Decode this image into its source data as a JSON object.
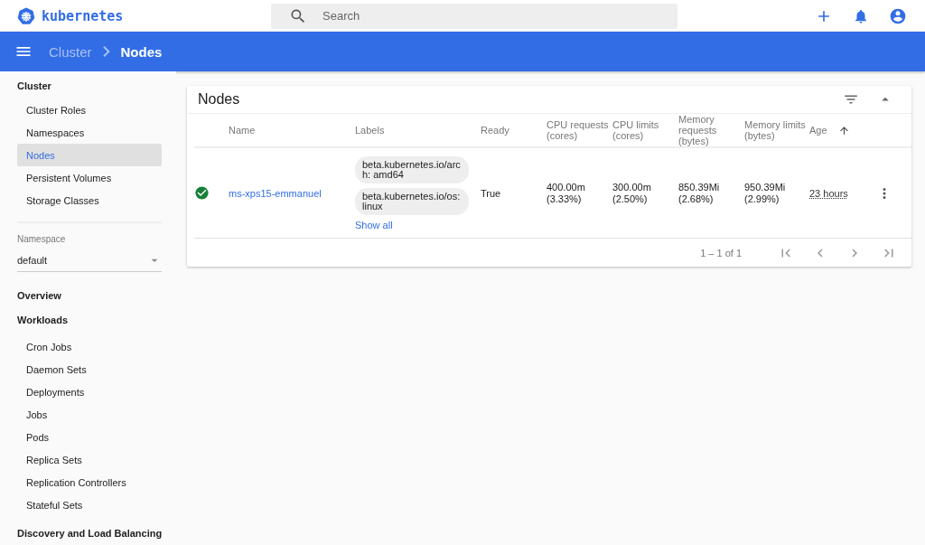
{
  "header": {
    "brand": "kubernetes",
    "search": {
      "placeholder": "Search"
    }
  },
  "toolbar": {
    "breadcrumbs": [
      {
        "label": "Cluster",
        "current": false
      },
      {
        "label": "Nodes",
        "current": true
      }
    ]
  },
  "sidebar": [
    {
      "kind": "section",
      "title": "Cluster",
      "items": [
        {
          "label": "Cluster Roles",
          "selected": false
        },
        {
          "label": "Namespaces",
          "selected": false
        },
        {
          "label": "Nodes",
          "selected": true
        },
        {
          "label": "Persistent Volumes",
          "selected": false
        },
        {
          "label": "Storage Classes",
          "selected": false
        }
      ]
    },
    {
      "kind": "namespace",
      "label": "Namespace",
      "value": "default"
    },
    {
      "kind": "section",
      "title": "Overview"
    },
    {
      "kind": "section",
      "title": "Workloads",
      "items": [
        {
          "label": "Cron Jobs",
          "selected": false
        },
        {
          "label": "Daemon Sets",
          "selected": false
        },
        {
          "label": "Deployments",
          "selected": false
        },
        {
          "label": "Jobs",
          "selected": false
        },
        {
          "label": "Pods",
          "selected": false
        },
        {
          "label": "Replica Sets",
          "selected": false
        },
        {
          "label": "Replication Controllers",
          "selected": false
        },
        {
          "label": "Stateful Sets",
          "selected": false
        }
      ]
    },
    {
      "kind": "section",
      "title": "Discovery and Load Balancing"
    }
  ],
  "card": {
    "title": "Nodes",
    "columns": [
      {
        "label": "Name",
        "sorted": false
      },
      {
        "label": "Labels",
        "sorted": false
      },
      {
        "label": "Ready",
        "sorted": false
      },
      {
        "label": "CPU requests (cores)",
        "sorted": false
      },
      {
        "label": "CPU limits (cores)",
        "sorted": false
      },
      {
        "label": "Memory requests (bytes)",
        "sorted": false
      },
      {
        "label": "Memory limits (bytes)",
        "sorted": false
      },
      {
        "label": "Age",
        "sorted": true
      }
    ],
    "rows": [
      {
        "healthy": true,
        "name": "ms-xps15-emmanuel",
        "labels": [
          "beta.kubernetes.io/arch: amd64",
          "beta.kubernetes.io/os: linux"
        ],
        "show_all": "Show all",
        "ready": "True",
        "cpu_requests": [
          "400.00m",
          "(3.33%)"
        ],
        "cpu_limits": [
          "300.00m",
          "(2.50%)"
        ],
        "memory_requests": [
          "850.39Mi",
          "(2.68%)"
        ],
        "memory_limits": [
          "950.39Mi",
          "(2.99%)"
        ],
        "age": "23 hours"
      }
    ],
    "pagination": "1 – 1 of 1"
  }
}
